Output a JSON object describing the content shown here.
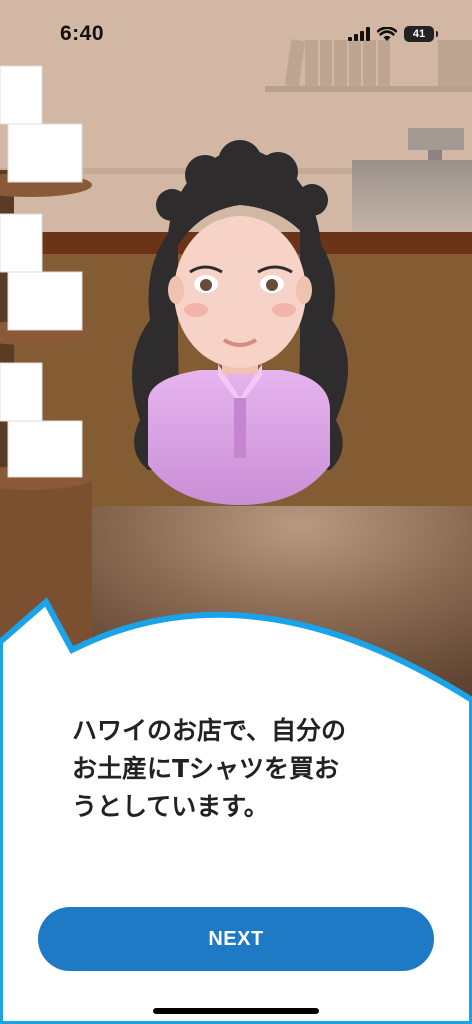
{
  "status_bar": {
    "time": "6:40",
    "battery_level": "41"
  },
  "dialog": {
    "caption_line1": "ハワイのお店で、自分の",
    "caption_line2": "お土産にTシャツを買お",
    "caption_line3": "うとしています。"
  },
  "actions": {
    "next_label": "NEXT"
  },
  "colors": {
    "accent": "#1f7ac6",
    "bubble_border": "#1aa3e8",
    "shirt": "#d8a0e2"
  }
}
